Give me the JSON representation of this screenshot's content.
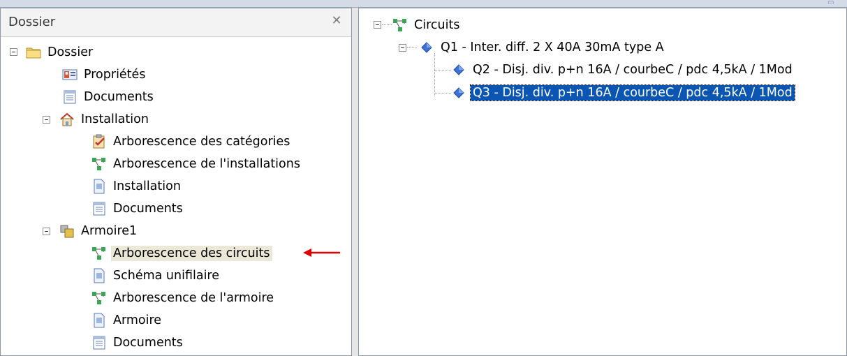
{
  "left_panel": {
    "title": "Dossier",
    "close_glyph": "✕",
    "tree": {
      "root": "Dossier",
      "root_items": [
        "Propriétés",
        "Documents"
      ],
      "installation": {
        "label": "Installation",
        "items": [
          "Arborescence des catégories",
          "Arborescence de l'installations",
          "Installation",
          "Documents"
        ]
      },
      "armoire": {
        "label": "Armoire1",
        "items": [
          "Arborescence des circuits",
          "Schéma unifilaire",
          "Arborescence de l'armoire",
          "Armoire",
          "Documents"
        ],
        "selected_index": 0
      }
    }
  },
  "right_panel": {
    "tree": {
      "root": "Circuits",
      "q1": "Q1 - Inter. diff. 2 X 40A 30mA type A",
      "children": [
        "Q2 - Disj. div. p+n 16A / courbeC / pdc 4,5kA / 1Mod",
        "Q3 - Disj. div. p+n 16A / courbeC / pdc 4,5kA / 1Mod"
      ],
      "selected_index": 1
    }
  },
  "icons": {
    "folder": "folder-icon",
    "properties": "properties-card-icon",
    "documents": "document-list-icon",
    "installation": "house-icon",
    "categories": "clipboard-check-icon",
    "tree": "network-tree-icon",
    "page": "page-icon",
    "cabinet": "stacked-boxes-icon",
    "device": "blue-diamond-icon"
  },
  "colors": {
    "selection_blue": "#0a56b2",
    "selection_grey": "#ece8d8",
    "annotation_arrow": "#e00000"
  }
}
